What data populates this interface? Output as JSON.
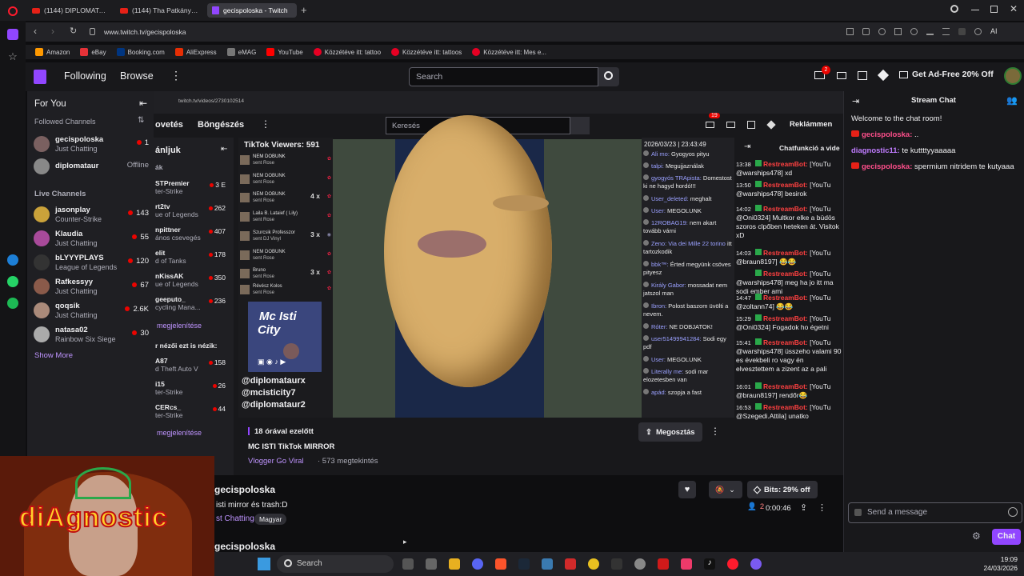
{
  "browser": {
    "tabs": [
      {
        "label": "(1144) DIPLOMATA ÚR - Y"
      },
      {
        "label": "(1144) Tha Patkányz - Gor"
      },
      {
        "label": "gecispoloska - Twitch"
      }
    ],
    "url": "www.twitch.tv/gecispoloska",
    "bookmarks": [
      {
        "label": "Amazon",
        "color": "#ff9900"
      },
      {
        "label": "eBay",
        "color": "#e53238"
      },
      {
        "label": "Booking.com",
        "color": "#003580"
      },
      {
        "label": "AliExpress",
        "color": "#e62e04"
      },
      {
        "label": "eMAG",
        "color": "#555555"
      },
      {
        "label": "YouTube",
        "color": "#ff0000"
      },
      {
        "label": "Közzétéve itt: tattoo",
        "color": "#e60023"
      },
      {
        "label": "Közzétéve itt: tattoos",
        "color": "#e60023"
      },
      {
        "label": "Közzétéve itt: Mes e...",
        "color": "#e60023"
      }
    ]
  },
  "topnav": {
    "following": "Following",
    "browse": "Browse",
    "search_placeholder": "Search",
    "notif_badge": "2",
    "ad_free": "Get Ad-Free 20% Off"
  },
  "sidebar": {
    "for_you": "For You",
    "followed_heading": "Followed Channels",
    "followed": [
      {
        "name": "gecispoloska",
        "game": "Just Chatting",
        "viewers": "1"
      },
      {
        "name": "diplomataur",
        "game": "",
        "viewers": "Offline"
      }
    ],
    "live_heading": "Live Channels",
    "live": [
      {
        "name": "jasonplay",
        "game": "Counter-Strike",
        "viewers": "143"
      },
      {
        "name": "Klaudia",
        "game": "Just Chatting",
        "viewers": "55"
      },
      {
        "name": "bLYYYPLAYS",
        "game": "League of Legends",
        "viewers": "120"
      },
      {
        "name": "Rafkessyy",
        "game": "Just Chatting",
        "viewers": "67"
      },
      {
        "name": "qoqsik",
        "game": "Just Chatting",
        "viewers": "2.6K"
      },
      {
        "name": "natasa02",
        "game": "Rainbow Six Siege",
        "viewers": "30"
      }
    ],
    "show_more": "Show More"
  },
  "nested": {
    "url": "twitch.tv/videos/2730102514",
    "nav_following": "ovetés",
    "nav_browse": "Böngészés",
    "search_placeholder": "Keresés",
    "badge": "19",
    "ad_label": "Reklámmen",
    "section": "ánljuk",
    "section2": "ák",
    "channels": [
      {
        "name": "STPremier",
        "game": "ter-Strike",
        "viewers": "3 E"
      },
      {
        "name": "rt2tv",
        "game": "ue of Legends",
        "viewers": "262"
      },
      {
        "name": "npittner",
        "game": "ános csevegés",
        "viewers": "407"
      },
      {
        "name": "elit",
        "game": "d of Tanks",
        "viewers": "178"
      },
      {
        "name": "nKissAK",
        "game": "ue of Legends",
        "viewers": "350"
      },
      {
        "name": "geeputo_",
        "game": "cycling Mana...",
        "viewers": "236"
      }
    ],
    "show_more": "megjelenítése",
    "also_watch": "r nézői ezt is nézik:",
    "channels2": [
      {
        "name": "A87",
        "game": "d Theft Auto V",
        "viewers": "158"
      },
      {
        "name": "i15",
        "game": "ter-Strike",
        "viewers": "26"
      },
      {
        "name": "CERcs_",
        "game": "ter-Strike",
        "viewers": "44"
      }
    ],
    "show_more2": "megjelenítése",
    "tiktok_viewers": "TikTok Viewers: 591",
    "tiktok_rows": [
      {
        "name": "NEM DOBUNK",
        "sub": "sent Rose",
        "mult": ""
      },
      {
        "name": "NEM DOBUNK",
        "sub": "sent Rose",
        "mult": ""
      },
      {
        "name": "NEM DOBUNK",
        "sub": "sent Rose",
        "mult": "4 x"
      },
      {
        "name": "Laila B. Lataief ( Lily)",
        "sub": "sent Rose",
        "mult": ""
      },
      {
        "name": "Szurcsik Professzor",
        "sub": "sent DJ Vinyl",
        "mult": "3 x"
      },
      {
        "name": "NEM DOBUNK",
        "sub": "sent Rose",
        "mult": ""
      },
      {
        "name": "Bruno",
        "sub": "sent Rose",
        "mult": "3 x"
      },
      {
        "name": "Révész Kolos",
        "sub": "sent Rose",
        "mult": ""
      }
    ],
    "promo_title1": "Mc Isti",
    "promo_title2": "City",
    "promo_handles": [
      "@diplomataurx",
      "@mcisticity7",
      "@diplomataur2"
    ],
    "timestamp": "2026/03/23 | 23:43:49",
    "ic_chat": [
      {
        "user": "Ali mo:",
        "text": "Gyogyos pityu"
      },
      {
        "user": "talpi:",
        "text": "Megujjaználak"
      },
      {
        "user": "gyogyós TRApista:",
        "text": "Domestost ki ne hagyd hordó!!!"
      },
      {
        "user": "User_deleted:",
        "text": "meghalt"
      },
      {
        "user": "User:",
        "text": "MEGOLUNK"
      },
      {
        "user": "12ROBAG19:",
        "text": "nem akart tovább várni"
      },
      {
        "user": "Zeno: Via dei Mille 22 torino",
        "text": "itt tartozkodik"
      },
      {
        "user": "bbk™:",
        "text": "Érted megyünk csöves pityesz"
      },
      {
        "user": "Király Gabor:",
        "text": "mossadat nem jatszol man"
      },
      {
        "user": "Ibron:",
        "text": "Polost baszom üvölti a nevem."
      },
      {
        "user": "Róter:",
        "text": "NE DOBJATOK!"
      },
      {
        "user": "user51499941284:",
        "text": "Sodi egy pdf"
      },
      {
        "user": "User:",
        "text": "MEGOLUNK"
      },
      {
        "user": "Literally me:",
        "text": "sodi mar elozetesben van"
      },
      {
        "user": "apád:",
        "text": "szopja a fast"
      }
    ],
    "chat_header": "Chatfunkció a vide",
    "bot_msgs": [
      {
        "time": "13:38",
        "user": "RestreamBot:",
        "text": "[YouTu @warships478] xd"
      },
      {
        "time": "13:50",
        "user": "RestreamBot:",
        "text": "[YouTu @warships478] besirok"
      },
      {
        "time": "14:02",
        "user": "RestreamBot:",
        "text": "[YouTu @Oni0324] Multkor elke a büdös szoros clpőben heteken át. Visitok xD"
      },
      {
        "time": "14:03",
        "user": "RestreamBot:",
        "text": "[YouTu @braun8197] 😂😂"
      },
      {
        "time": "",
        "user": "RestreamBot:",
        "text": "[YouTu @warships478] meg ha jo itt ma sodi ember ami"
      },
      {
        "time": "14:47",
        "user": "RestreamBot:",
        "text": "[YouTu @zoltann74] 😂😂"
      },
      {
        "time": "15:29",
        "user": "RestreamBot:",
        "text": "[YouTu @Oni0324] Fogadok ho égetni"
      },
      {
        "time": "15:41",
        "user": "RestreamBot:",
        "text": "[YouTu @warships478] üsszeho valami 90 es évekbeli ro vagy én elvesztettem a zizent az a pali"
      },
      {
        "time": "16:01",
        "user": "RestreamBot:",
        "text": "[YouTu @braun8197] rendőr😂"
      },
      {
        "time": "16:53",
        "user": "RestreamBot:",
        "text": "[YouTu @Szegedi.Attila] unatko"
      }
    ],
    "video_age": "18 órával ezelőtt",
    "video_title": "MC ISTI TikTok MIRROR",
    "channel": "Vlogger Go Viral",
    "views": "· 573 megtekintés",
    "share": "Megosztás"
  },
  "stream": {
    "channel": "gecispoloska",
    "title": "isti mirror és trash:D",
    "category": "st Chatting",
    "tag": "Magyar",
    "bits": "Bits: 29% off",
    "viewers": "2",
    "uptime": "0:00:46",
    "channel2": "gecispoloska"
  },
  "chat": {
    "title": "Stream Chat",
    "messages": [
      {
        "user": "",
        "text": "Welcome to the chat room!",
        "color": "#efeff1"
      },
      {
        "user": "gecispoloska:",
        "text": "..",
        "color": "#ff4f8b"
      },
      {
        "user": "diagnostic11:",
        "text": "te kuttttyyaaaaa",
        "color": "#c07cff"
      },
      {
        "user": "gecispoloska:",
        "text": "spermium nitridem te kutyaaa",
        "color": "#ff4f8b"
      }
    ],
    "placeholder": "Send a message",
    "send": "Chat"
  },
  "webcam": {
    "overlay": "diAgnostic"
  },
  "taskbar": {
    "search": "Search",
    "time": "19:09",
    "date": "24/03/2026"
  },
  "colors": {
    "accent": "#9146ff",
    "live": "#eb0400",
    "bot": "#ff4040"
  }
}
